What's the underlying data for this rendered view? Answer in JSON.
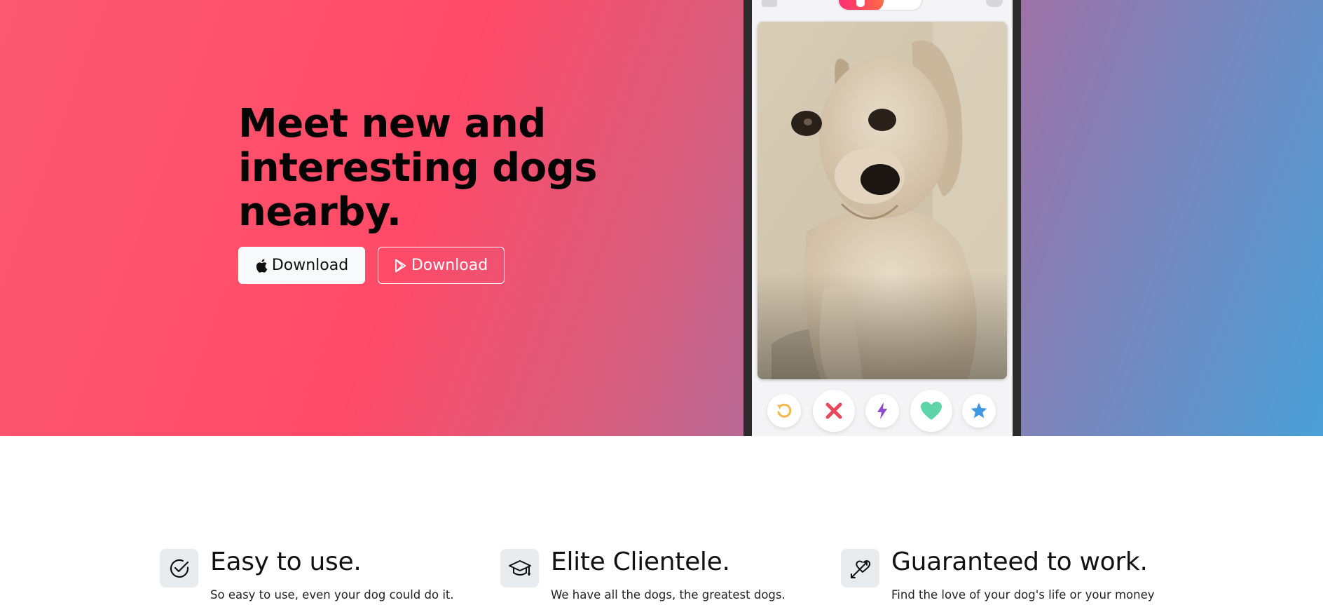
{
  "hero": {
    "headline": "Meet new and interesting dogs nearby.",
    "apple_button_label": "Download",
    "play_button_label": "Download",
    "gradient_colors": [
      "#fb5a70",
      "#ff4a68",
      "#d95c7c",
      "#9a73a8",
      "#4aa0d8"
    ]
  },
  "phone": {
    "icons": {
      "profile": "profile-icon",
      "toggle": "flame-paw-toggle",
      "chat": "chat-icon"
    },
    "actions": [
      {
        "name": "rewind-button",
        "icon": "rewind-icon",
        "color": "#f5b748"
      },
      {
        "name": "nope-button",
        "icon": "x-icon",
        "color": "#e9475b"
      },
      {
        "name": "boost-button",
        "icon": "lightning-icon",
        "color": "#8a4bd2"
      },
      {
        "name": "like-button",
        "icon": "heart-icon",
        "color": "#5fd4a8"
      },
      {
        "name": "super-like-button",
        "icon": "star-icon",
        "color": "#3f97e0"
      }
    ]
  },
  "features": [
    {
      "icon": "check-circle-icon",
      "title": "Easy to use.",
      "text": "So easy to use, even your dog could do it."
    },
    {
      "icon": "mortarboard-icon",
      "title": "Elite Clientele.",
      "text": "We have all the dogs, the greatest dogs."
    },
    {
      "icon": "arrow-heart-icon",
      "title": "Guaranteed to work.",
      "text": "Find the love of your dog's life or your money"
    }
  ]
}
